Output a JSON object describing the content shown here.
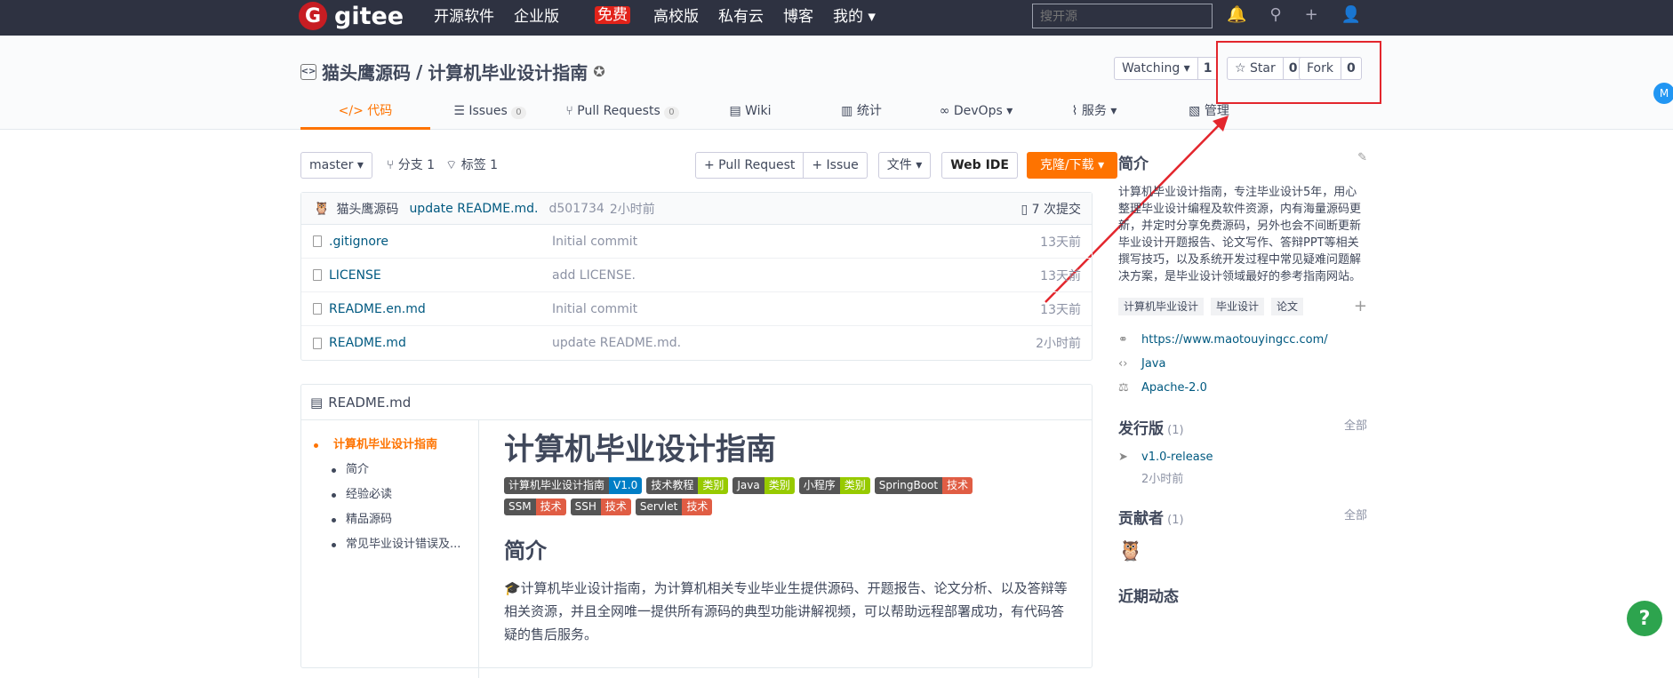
{
  "nav": {
    "logo_letter": "G",
    "logo_text": "gitee",
    "links": [
      "开源软件",
      "企业版",
      "高校版",
      "私有云",
      "博客",
      "我的 ▾"
    ],
    "free_badge": "免费",
    "search_placeholder": "搜开源"
  },
  "repo": {
    "owner": "猫头鹰源码",
    "sep": " / ",
    "name": "计算机毕业设计指南",
    "watch_label": "Watching ▾",
    "watch_count": "1",
    "star_label": "☆ Star",
    "star_count": "0",
    "fork_label": "Fork",
    "fork_count": "0"
  },
  "tabs": [
    {
      "label": "</> 代码"
    },
    {
      "label": "Issues",
      "count": "0"
    },
    {
      "label": "Pull Requests",
      "count": "0"
    },
    {
      "label": "Wiki"
    },
    {
      "label": "统计"
    },
    {
      "label": "DevOps ▾"
    },
    {
      "label": "服务 ▾"
    },
    {
      "label": "管理"
    }
  ],
  "toolbar": {
    "branch": "master ▾",
    "branches": "分支 1",
    "tags": "标签 1",
    "pull_request": "+ Pull Request",
    "issue": "+ Issue",
    "file": "文件 ▾",
    "webide": "Web IDE",
    "clone": "克隆/下载 ▾"
  },
  "commit": {
    "author": "猫头鹰源码",
    "message": "update README.md.",
    "hash": "d501734",
    "time": "2小时前",
    "count": "7 次提交"
  },
  "files": [
    {
      "name": ".gitignore",
      "message": "Initial commit",
      "time": "13天前"
    },
    {
      "name": "LICENSE",
      "message": "add LICENSE.",
      "time": "13天前"
    },
    {
      "name": "README.en.md",
      "message": "Initial commit",
      "time": "13天前"
    },
    {
      "name": "README.md",
      "message": "update README.md.",
      "time": "2小时前"
    }
  ],
  "readme": {
    "filename": "README.md",
    "toc": [
      "计算机毕业设计指南",
      "简介",
      "经验必读",
      "精品源码",
      "常见毕业设计错误及..."
    ],
    "h1": "计算机毕业设计指南",
    "shields": [
      {
        "l": "计算机毕业设计指南",
        "r": "V1.0",
        "color": "#007ec6"
      },
      {
        "l": "技术教程",
        "r": "类别",
        "color": "#97ca00"
      },
      {
        "l": "Java",
        "r": "类别",
        "color": "#97ca00"
      },
      {
        "l": "小程序",
        "r": "类别",
        "color": "#97ca00"
      },
      {
        "l": "SpringBoot",
        "r": "技术",
        "color": "#e05d44"
      },
      {
        "l": "SSM",
        "r": "技术",
        "color": "#e05d44"
      },
      {
        "l": "SSH",
        "r": "技术",
        "color": "#e05d44"
      },
      {
        "l": "Servlet",
        "r": "技术",
        "color": "#e05d44"
      }
    ],
    "h2": "简介",
    "para": "🎓计算机毕业设计指南，为计算机相关专业毕业生提供源码、开题报告、论文分析、以及答辩等相关资源，并且全网唯一提供所有源码的典型功能讲解视频，可以帮助远程部署成功，有代码答疑的售后服务。"
  },
  "side": {
    "intro_title": "简介",
    "intro": "计算机毕业设计指南，专注毕业设计5年，用心整理毕业设计编程及软件资源，内有海量源码更新，并定时分享免费源码，另外也会不间断更新毕业设计开题报告、论文写作、答辩PPT等相关撰写技巧，以及系统开发过程中常见疑难问题解决方案，是毕业设计领域最好的参考指南网站。",
    "tags": [
      "计算机毕业设计",
      "毕业设计",
      "论文"
    ],
    "url": "https://www.maotouyingcc.com/",
    "lang": "Java",
    "license": "Apache-2.0",
    "release_title": "发行版",
    "release_count": "(1)",
    "all": "全部",
    "release_name": "v1.0-release",
    "release_time": "2小时前",
    "contrib_title": "贡献者",
    "contrib_count": "(1)",
    "recent": "近期动态"
  },
  "help": "?"
}
